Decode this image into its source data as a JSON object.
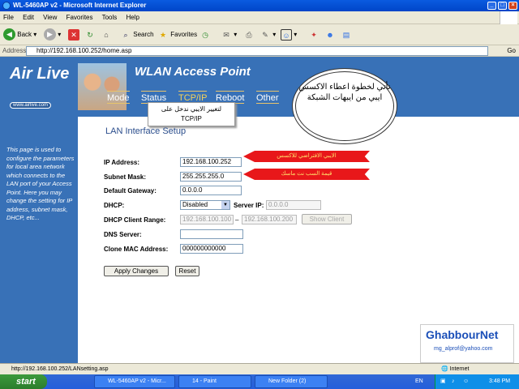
{
  "window": {
    "title": "WL-5460AP v2 - Microsoft Internet Explorer"
  },
  "menu": [
    "File",
    "Edit",
    "View",
    "Favorites",
    "Tools",
    "Help"
  ],
  "toolbar": {
    "back": "Back",
    "search": "Search",
    "favorites": "Favorites"
  },
  "address": {
    "label": "Address",
    "url": "http://192.168.100.252/home.asp",
    "go": "Go"
  },
  "header": {
    "brand": "Air Live",
    "brand_url": "www.airlive.com",
    "product": "WLAN Access Point"
  },
  "tabs": [
    "Mode",
    "Status",
    "TCP/IP",
    "Reboot",
    "Other"
  ],
  "tooltip": {
    "line1": "لتغيير الايبي ندخل على",
    "line2": "TCP/IP"
  },
  "cloud": "نأتي لخطوة اعطاء الاكسس ايبي من ايبهات الشبكة",
  "sidebar_text": "This page is used to configure the parameters for local area network which connects to the LAN port of your Access Point. Here you may change the setting for IP address, subnet mask, DHCP, etc...",
  "page_title": "LAN Interface Setup",
  "form": {
    "ip_label": "IP Address:",
    "ip_value": "192.168.100.252",
    "mask_label": "Subnet Mask:",
    "mask_value": "255.255.255.0",
    "gw_label": "Default Gateway:",
    "gw_value": "0.0.0.0",
    "dhcp_label": "DHCP:",
    "dhcp_value": "Disabled",
    "server_ip_label": "Server IP:",
    "server_ip_value": "0.0.0.0",
    "range_label": "DHCP Client Range:",
    "range_start": "192.168.100.100",
    "range_sep": "–",
    "range_end": "192.168.100.200",
    "show_client": "Show Client",
    "dns_label": "DNS Server:",
    "dns_value": "",
    "mac_label": "Clone MAC Address:",
    "mac_value": "000000000000",
    "apply": "Apply Changes",
    "reset": "Reset"
  },
  "annotations": {
    "ip_arrow": "الايبي الافتراضي للاكسس",
    "mask_arrow": "قيمة السب نت ماسك"
  },
  "watermark": {
    "name": "GhabbourNet",
    "email": "mg_alprof@yahoo.com"
  },
  "status": {
    "text": "http://192.168.100.252/LANsetting.asp",
    "zone": "Internet"
  },
  "taskbar": {
    "start": "start",
    "tasks": [
      "WL-5460AP v2 - Micr...",
      "14 - Paint",
      "New Folder (2)"
    ],
    "lang": "EN",
    "clock": "3:48 PM"
  },
  "colors": {
    "panel": "#3871b7",
    "accent": "#f7d25a",
    "arrow": "#e8171a"
  }
}
